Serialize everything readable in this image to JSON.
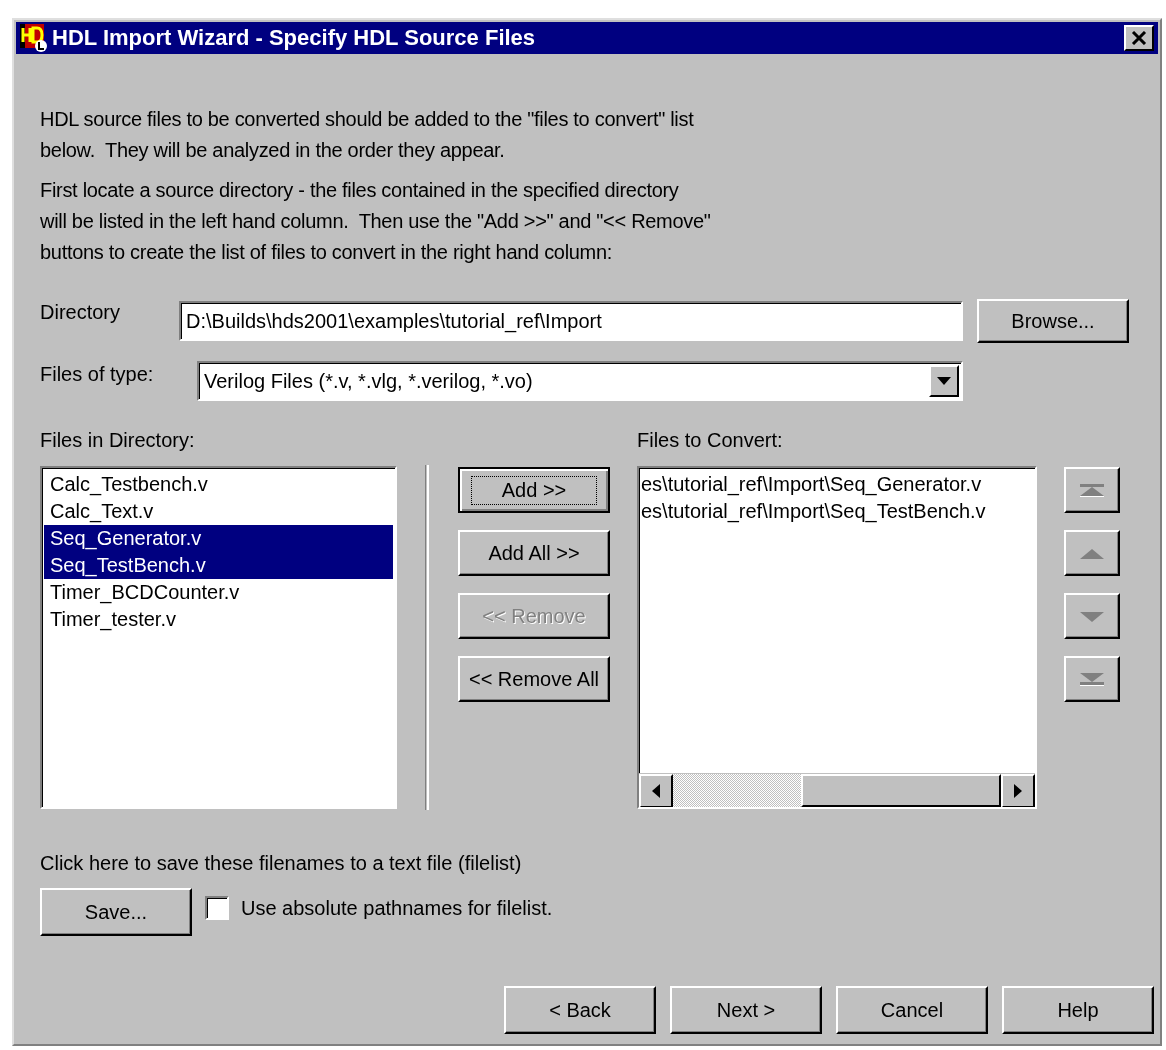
{
  "window": {
    "title": "HDL Import Wizard - Specify HDL Source Files"
  },
  "intro": [
    "HDL source files to be converted should be added to the \"files to convert\" list\nbelow.  They will be analyzed in the order they appear.",
    "First locate a source directory - the files contained in the specified directory\nwill be listed in the left hand column.  Then use the \"Add >>\" and \"<< Remove\"\nbuttons to create the list of files to convert in the right hand column:"
  ],
  "directory": {
    "label": "Directory",
    "value": "D:\\Builds\\hds2001\\examples\\tutorial_ref\\Import",
    "button": "Browse..."
  },
  "file_type": {
    "label": "Files of type:",
    "value": "Verilog Files (*.v, *.vlg, *.verilog, *.vo)"
  },
  "files_in_directory": {
    "label": "Files in Directory:",
    "items": [
      {
        "name": "Calc_Testbench.v",
        "selected": false
      },
      {
        "name": "Calc_Text.v",
        "selected": false
      },
      {
        "name": "Seq_Generator.v",
        "selected": true
      },
      {
        "name": "Seq_TestBench.v",
        "selected": true
      },
      {
        "name": "Timer_BCDCounter.v",
        "selected": false
      },
      {
        "name": "Timer_tester.v",
        "selected": false
      }
    ]
  },
  "transfer_buttons": [
    {
      "label": "Add >>",
      "disabled": false,
      "focused": true
    },
    {
      "label": "Add All >>",
      "disabled": false,
      "focused": false
    },
    {
      "label": "<< Remove",
      "disabled": true,
      "focused": false
    },
    {
      "label": "<< Remove All",
      "disabled": false,
      "focused": false
    }
  ],
  "files_to_convert": {
    "label": "Files to Convert:",
    "items": [
      {
        "name": "es\\tutorial_ref\\Import\\Seq_Generator.v",
        "selected": false
      },
      {
        "name": "es\\tutorial_ref\\Import\\Seq_TestBench.v",
        "selected": false
      }
    ]
  },
  "order_buttons": [
    {
      "kind": "top"
    },
    {
      "kind": "up"
    },
    {
      "kind": "down"
    },
    {
      "kind": "bottom"
    }
  ],
  "save_hint": "Click here to save these filenames to a text file (filelist)",
  "save_button": "Save...",
  "absolute_pathnames": {
    "label": "Use absolute pathnames for filelist.",
    "checked": false
  },
  "nav_buttons": [
    "< Back",
    "Next >",
    "Cancel",
    "Help"
  ]
}
